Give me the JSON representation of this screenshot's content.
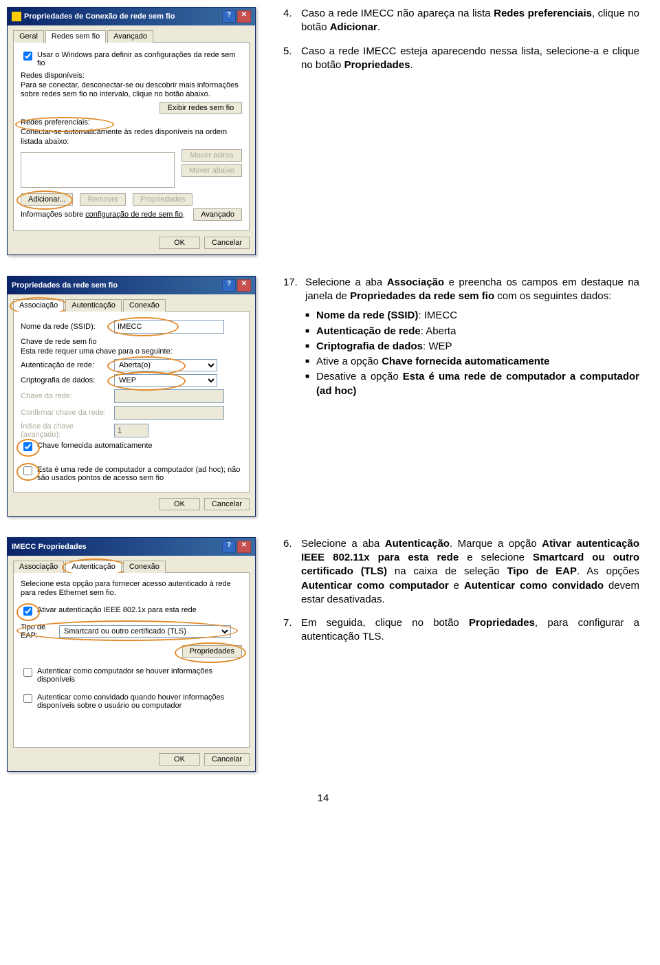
{
  "page_number": "14",
  "dialog1": {
    "title": "Propriedades de Conexão de rede sem fio",
    "help_btn": "?",
    "close_btn": "✕",
    "tabs": {
      "t1": "Geral",
      "t2": "Redes sem fio",
      "t3": "Avançado"
    },
    "use_windows_label": "Usar o Windows para definir as configurações da rede sem fio",
    "available_header": "Redes disponíveis:",
    "available_text": "Para se conectar, desconectar-se ou descobrir mais informações sobre redes sem fio no intervalo, clique no botão abaixo.",
    "show_networks_btn": "Exibir redes sem fio",
    "pref_header": "Redes preferenciais:",
    "pref_text": "Conectar-se automaticamente às redes disponíveis na ordem listada abaixo:",
    "moveup_btn": "Mover acima",
    "movedown_btn": "Mover abaixo",
    "add_btn": "Adicionar...",
    "remove_btn": "Remover",
    "props_btn": "Propriedades",
    "moreinfo_text": "Informações sobre ",
    "moreinfo_link": "configuração de rede sem fio",
    "advanced_btn": "Avançado",
    "ok_btn": "OK",
    "cancel_btn": "Cancelar"
  },
  "instr1": {
    "n4": "4.",
    "t4": "Caso a rede IMECC não apareça na lista ",
    "t4b": "Redes preferenciais",
    "t4c": ", clique no botão ",
    "t4d": "Adicionar",
    "t4e": ".",
    "n5": "5.",
    "t5": "Caso a rede IMECC esteja aparecendo nessa lista, selecione-a e clique no botão ",
    "t5b": "Propriedades",
    "t5c": "."
  },
  "dialog2": {
    "title": "Propriedades da rede sem fio",
    "tabs": {
      "t1": "Associação",
      "t2": "Autenticação",
      "t3": "Conexão"
    },
    "ssid_label": "Nome da rede (SSID):",
    "ssid_value": "IMECC",
    "keygroup": "Chave de rede sem fio",
    "keytext": "Esta rede requer uma chave para o seguinte:",
    "auth_label": "Autenticação de rede:",
    "auth_value": "Aberta(o)",
    "crypt_label": "Criptografia de dados:",
    "crypt_value": "WEP",
    "key_label": "Chave da rede:",
    "confirm_label": "Confirmar chave da rede:",
    "idx_label": "Índice da chave (avançado):",
    "idx_value": "1",
    "autokey_label": "Chave fornecida automaticamente",
    "adhoc_label": "Esta é uma rede de computador a computador (ad hoc); não são usados pontos de acesso sem fio",
    "ok_btn": "OK",
    "cancel_btn": "Cancelar"
  },
  "instr2": {
    "n17": "17.",
    "t17a": "Selecione a aba ",
    "t17b": "Associação",
    "t17c": " e preencha os campos em destaque na janela de ",
    "t17d": "Propriedades da rede sem fio",
    "t17e": " com os seguintes dados:",
    "b1a": "Nome da rede (SSID)",
    "b1b": ": IMECC",
    "b2a": "Autenticação de rede",
    "b2b": ": Aberta",
    "b3a": "Criptografia de dados",
    "b3b": ": WEP",
    "b4a": "Ative a opção ",
    "b4b": "Chave fornecida automaticamente",
    "b5a": "Desative a opção ",
    "b5b": "Esta é uma rede de computador a computador (ad hoc)"
  },
  "dialog3": {
    "title": "IMECC Propriedades",
    "tabs": {
      "t1": "Associação",
      "t2": "Autenticação",
      "t3": "Conexão"
    },
    "intro": "Selecione esta opção para fornecer acesso autenticado à rede para redes Ethernet sem fio.",
    "enable_label": "Ativar autenticação IEEE 802.1x para esta rede",
    "type_label": "Tipo de EAP:",
    "type_value": "Smartcard ou outro certificado (TLS)",
    "props_btn": "Propriedades",
    "comp_label": "Autenticar como computador se houver informações disponíveis",
    "guest_label": "Autenticar como convidado quando houver informações disponíveis sobre o usuário ou computador",
    "ok_btn": "OK",
    "cancel_btn": "Cancelar"
  },
  "instr3": {
    "n6": "6.",
    "t6a": "Selecione a aba ",
    "t6b": "Autenticação",
    "t6c": ".  Marque a opção ",
    "t6d": "Ativar autenticação IEEE 802.11x para esta rede",
    "t6e": " e selecione ",
    "t6f": "Smartcard ou outro certificado (TLS)",
    "t6g": " na caixa de seleção ",
    "t6h": "Tipo de EAP",
    "t6i": ". As opções ",
    "t6j": "Autenticar como computador",
    "t6k": " e ",
    "t6l": "Autenticar como convidado",
    "t6m": " devem estar desativadas.",
    "n7": "7.",
    "t7a": "Em seguida, clique no botão ",
    "t7b": "Propriedades",
    "t7c": ", para configurar a autenticação TLS."
  }
}
